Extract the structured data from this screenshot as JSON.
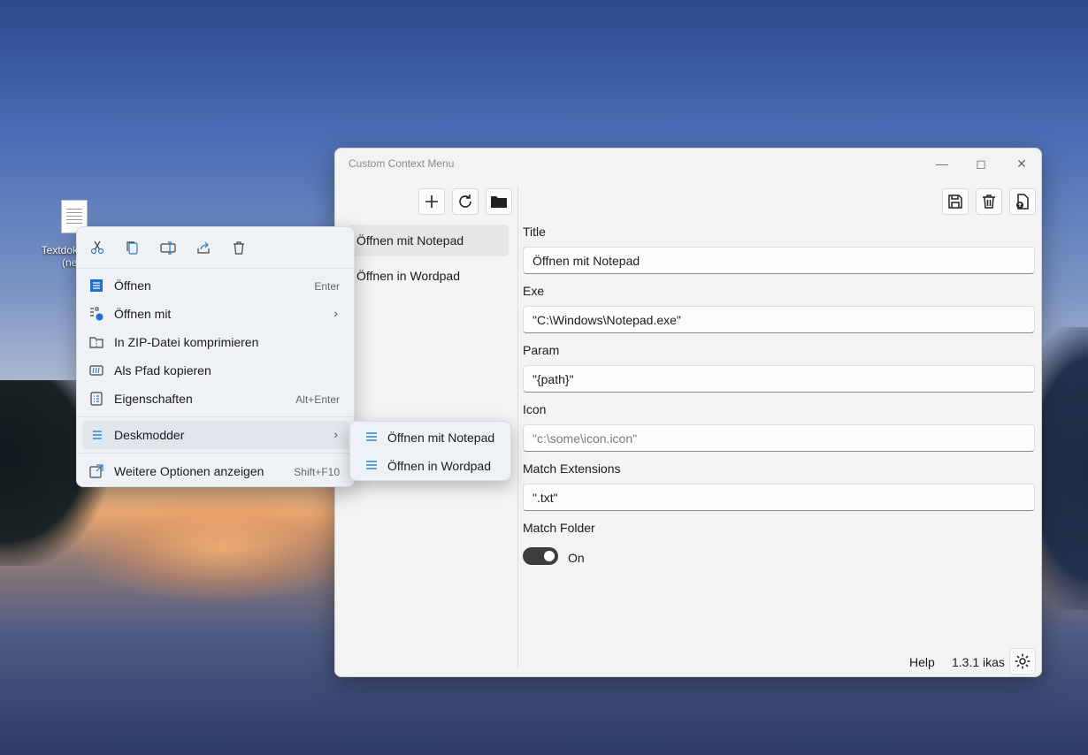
{
  "desktop": {
    "icon_label_line1": "Textdokument",
    "icon_label_line2": "(neu)"
  },
  "window": {
    "title": "Custom Context Menu",
    "sidebar": {
      "items": [
        {
          "label": "Öffnen mit Notepad",
          "active": true
        },
        {
          "label": "Öffnen in Wordpad",
          "active": false
        }
      ]
    },
    "form": {
      "title_label": "Title",
      "title_value": "Öffnen mit Notepad",
      "exe_label": "Exe",
      "exe_value": "\"C:\\Windows\\Notepad.exe\"",
      "param_label": "Param",
      "param_value": "\"{path}\"",
      "icon_label": "Icon",
      "icon_placeholder": "\"c:\\some\\icon.icon\"",
      "match_ext_label": "Match Extensions",
      "match_ext_value": "\".txt\"",
      "match_folder_label": "Match Folder",
      "match_folder_state": "On"
    },
    "footer": {
      "help": "Help",
      "version": "1.3.1 ikas"
    }
  },
  "context_menu": {
    "items": [
      {
        "label": "Öffnen",
        "shortcut": "Enter"
      },
      {
        "label": "Öffnen mit",
        "shortcut": ""
      },
      {
        "label": "In ZIP-Datei komprimieren",
        "shortcut": ""
      },
      {
        "label": "Als Pfad kopieren",
        "shortcut": ""
      },
      {
        "label": "Eigenschaften",
        "shortcut": "Alt+Enter"
      },
      {
        "label": "Deskmodder",
        "shortcut": ""
      },
      {
        "label": "Weitere Optionen anzeigen",
        "shortcut": "Shift+F10"
      }
    ],
    "submenu": [
      {
        "label": "Öffnen mit Notepad"
      },
      {
        "label": "Öffnen in Wordpad"
      }
    ]
  }
}
